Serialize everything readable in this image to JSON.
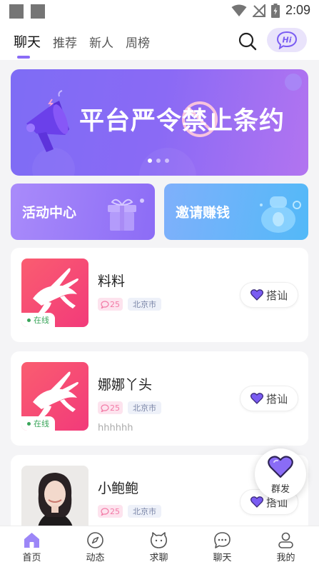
{
  "status_bar": {
    "time": "2:09"
  },
  "header": {
    "tabs": [
      {
        "label": "聊天",
        "active": true
      },
      {
        "label": "推荐",
        "active": false
      },
      {
        "label": "新人",
        "active": false
      },
      {
        "label": "周榜",
        "active": false
      }
    ],
    "hi_button_label": "Hi"
  },
  "banner": {
    "text": "平台严令禁止条约",
    "page_count": 3,
    "active_page": 1
  },
  "promos": [
    {
      "label": "活动中心"
    },
    {
      "label": "邀请赚钱"
    }
  ],
  "users": [
    {
      "name": "料料",
      "age": "25",
      "city": "北京市",
      "online_label": "在线",
      "signature": "",
      "action_label": "搭讪"
    },
    {
      "name": "娜娜丫头",
      "age": "25",
      "city": "北京市",
      "online_label": "在线",
      "signature": "hhhhhh",
      "action_label": "搭讪"
    },
    {
      "name": "小鲍鲍",
      "age": "25",
      "city": "北京市",
      "online_label": "",
      "signature": "",
      "action_label": "搭讪"
    }
  ],
  "fab": {
    "label": "群发"
  },
  "bottom_nav": [
    {
      "label": "首页",
      "icon": "home-icon",
      "active": true
    },
    {
      "label": "动态",
      "icon": "compass-icon",
      "active": false
    },
    {
      "label": "求聊",
      "icon": "cat-face-icon",
      "active": false
    },
    {
      "label": "聊天",
      "icon": "chat-bubble-icon",
      "active": false
    },
    {
      "label": "我的",
      "icon": "person-icon",
      "active": false
    }
  ],
  "colors": {
    "accent": "#8a6cf6",
    "online": "#3aa55a",
    "age_tag": "#f27aa6"
  }
}
